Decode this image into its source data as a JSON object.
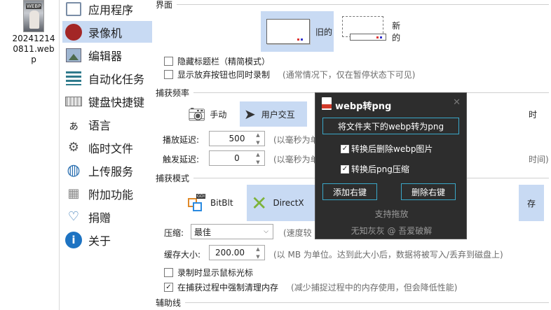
{
  "desktop": {
    "file_label": "20241214 0811.web p",
    "thumb_tag": "WEBP"
  },
  "sidebar": {
    "items": [
      {
        "label": "应用程序",
        "icon": "window-icon"
      },
      {
        "label": "录像机",
        "icon": "record-icon"
      },
      {
        "label": "编辑器",
        "icon": "image-editor-icon"
      },
      {
        "label": "自动化任务",
        "icon": "task-list-icon"
      },
      {
        "label": "键盘快捷键",
        "icon": "keyboard-icon"
      },
      {
        "label": "语言",
        "icon": "language-icon"
      },
      {
        "label": "临时文件",
        "icon": "temp-files-icon"
      },
      {
        "label": "上传服务",
        "icon": "globe-icon"
      },
      {
        "label": "附加功能",
        "icon": "extras-icon"
      },
      {
        "label": "捐赠",
        "icon": "donate-icon"
      },
      {
        "label": "关于",
        "icon": "info-icon"
      }
    ],
    "active_index": 1
  },
  "interface": {
    "title": "界面",
    "old_label": "旧的",
    "new_label": "新的",
    "hide_title_bar": "隐藏标题栏（精简模式）",
    "show_discard": "显示放弃按钮也同时录制",
    "show_discard_hint": "(通常情况下，仅在暂停状态下可见)"
  },
  "capture_freq": {
    "title": "捕获频率",
    "manual": "手动",
    "interaction": "用户交互",
    "timer_tail": "时",
    "playback_delay_label": "播放延迟:",
    "playback_delay_value": "500",
    "playback_delay_hint": "(以毫秒为单",
    "trigger_delay_label": "触发延迟:",
    "trigger_delay_value": "0",
    "trigger_delay_hint": "(以毫秒为单",
    "trigger_delay_tail": "时间)"
  },
  "capture_mode": {
    "title": "捕获模式",
    "bitblt": "BitBlt",
    "directx": "DirectX",
    "memory_tail": "存",
    "compression_label": "压缩:",
    "compression_value": "最佳",
    "compression_hint": "(速度较",
    "cache_label": "缓存大小:",
    "cache_value": "200.00",
    "cache_hint": "(以 MB 为单位。达到此大小后，数据将被写入/丢弃到磁盘上)",
    "show_cursor": "录制时显示鼠标光标",
    "force_gc": "在捕获过程中强制清理内存",
    "force_gc_hint": "(减少捕捉过程中的内存使用，但会降低性能)"
  },
  "guides": {
    "title": "辅助线"
  },
  "popup": {
    "title": "webp转png",
    "convert_btn": "将文件夹下的webp转为png",
    "delete_after": "转换后删除webp图片",
    "compress_png": "转换后png压缩",
    "add_context": "添加右键",
    "remove_context": "删除右键",
    "drag_support": "支持拖放",
    "credit": "无知灰灰 @ 吾爱破解",
    "close_glyph": "✕"
  },
  "colors": {
    "selection": "#c8daf3",
    "popup_bg": "#2d2d2d",
    "popup_border_btn": "#3aa7c8",
    "record_red": "#a32626"
  }
}
